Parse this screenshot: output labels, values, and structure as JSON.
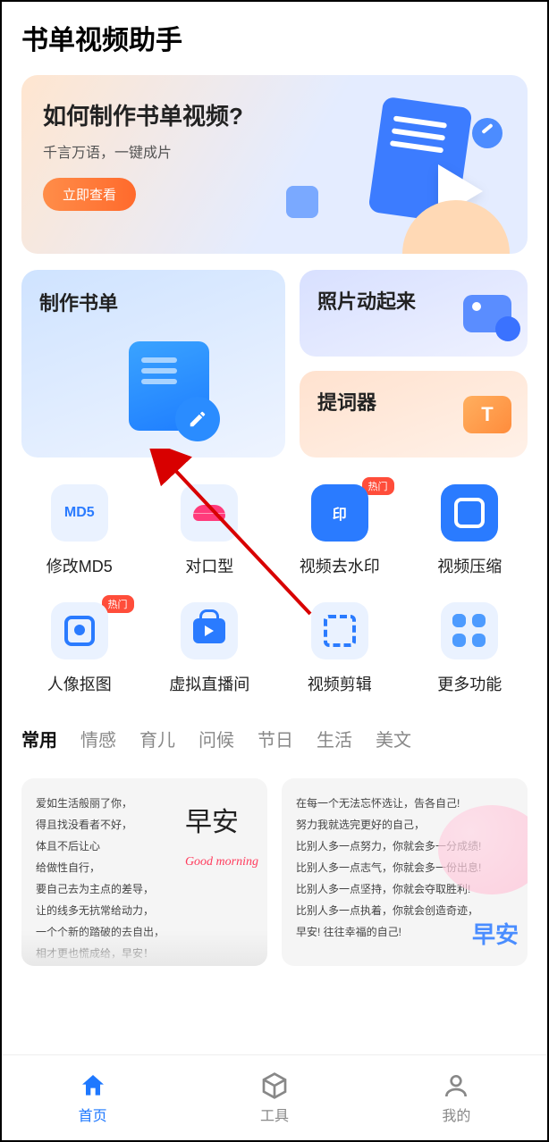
{
  "header": {
    "app_title": "书单视频助手"
  },
  "banner": {
    "title": "如何制作书单视频?",
    "subtitle": "千言万语，一键成片",
    "cta": "立即查看"
  },
  "feature_cards": {
    "make": "制作书单",
    "photo": "照片动起来",
    "teleprompter": "提词器",
    "teleprompter_glyph": "T"
  },
  "tools": [
    {
      "icon_text": "MD5",
      "label": "修改MD5",
      "badge": null
    },
    {
      "icon_text": "",
      "label": "对口型",
      "badge": null
    },
    {
      "icon_text": "印",
      "label": "视频去水印",
      "badge": "热门"
    },
    {
      "icon_text": "",
      "label": "视频压缩",
      "badge": null
    },
    {
      "icon_text": "",
      "label": "人像抠图",
      "badge": "热门"
    },
    {
      "icon_text": "",
      "label": "虚拟直播间",
      "badge": null
    },
    {
      "icon_text": "",
      "label": "视频剪辑",
      "badge": null
    },
    {
      "icon_text": "",
      "label": "更多功能",
      "badge": null
    }
  ],
  "category_tabs": [
    "常用",
    "情感",
    "育儿",
    "问候",
    "节日",
    "生活",
    "美文"
  ],
  "active_tab_index": 0,
  "templates": [
    {
      "lines": [
        "爱如生活般丽了你，",
        "得且找没看者不好，",
        "体且不后让心",
        "给做性自行，",
        "要自己去为主点的差导，",
        "让的线多无抗常给动力，",
        "一个个新的踏破的去自出，",
        "相才更也慌成给，早安！"
      ],
      "art_big": "早安",
      "art_red": "Good morning"
    },
    {
      "lines": [
        "在每一个无法忘怀选让，告各自己!",
        "努力我就选完更好的自己，",
        "比别人多一点努力，你就会多一分成绩!",
        "比别人多一点志气，你就会多一份出息!",
        "比别人多一点坚持，你就会夺取胜利!",
        "比别人多一点执着，你就会创造奇迹，",
        "早安! 往往幸福的自己!"
      ],
      "art_label": "早安"
    }
  ],
  "nav": {
    "home": "首页",
    "tools": "工具",
    "me": "我的",
    "active": 0
  }
}
